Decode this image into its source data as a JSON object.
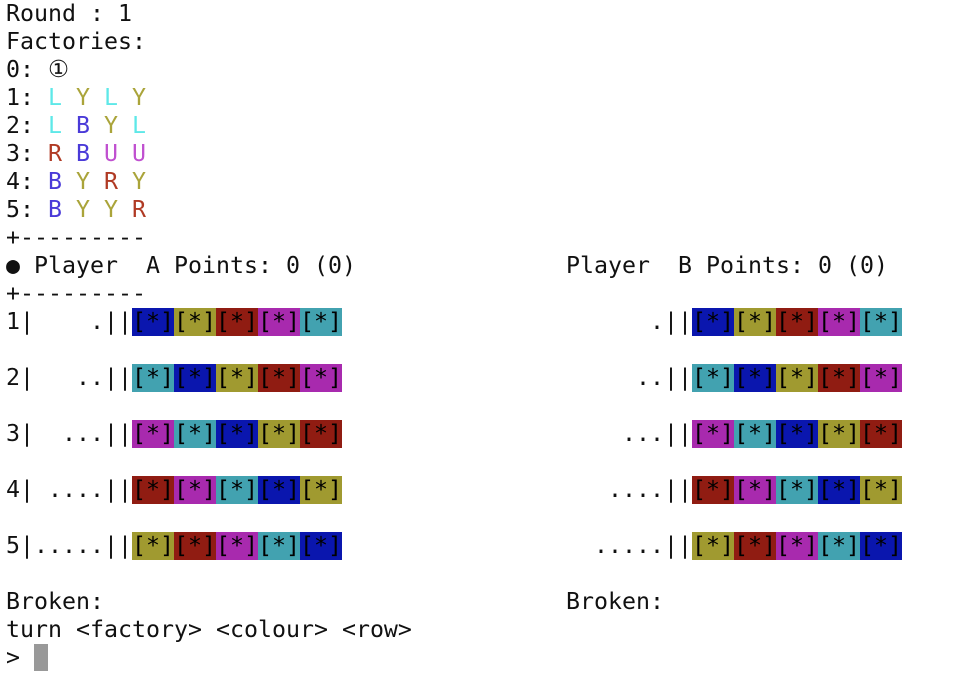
{
  "round_label": "Round : 1",
  "factories_label": "Factories:",
  "factories": [
    {
      "prefix": "0: ",
      "items": [
        {
          "t": "①",
          "c": "#111111"
        }
      ]
    },
    {
      "prefix": "1: ",
      "items": [
        {
          "t": "L",
          "c": "#5ee8e8"
        },
        {
          "t": "Y",
          "c": "#aaa43a"
        },
        {
          "t": "L",
          "c": "#5ee8e8"
        },
        {
          "t": "Y",
          "c": "#aaa43a"
        }
      ]
    },
    {
      "prefix": "2: ",
      "items": [
        {
          "t": "L",
          "c": "#5ee8e8"
        },
        {
          "t": "B",
          "c": "#4a3ad8"
        },
        {
          "t": "Y",
          "c": "#aaa43a"
        },
        {
          "t": "L",
          "c": "#5ee8e8"
        }
      ]
    },
    {
      "prefix": "3: ",
      "items": [
        {
          "t": "R",
          "c": "#b03a24"
        },
        {
          "t": "B",
          "c": "#4a3ad8"
        },
        {
          "t": "U",
          "c": "#c050d0"
        },
        {
          "t": "U",
          "c": "#c050d0"
        }
      ]
    },
    {
      "prefix": "4: ",
      "items": [
        {
          "t": "B",
          "c": "#4a3ad8"
        },
        {
          "t": "Y",
          "c": "#aaa43a"
        },
        {
          "t": "R",
          "c": "#b03a24"
        },
        {
          "t": "Y",
          "c": "#aaa43a"
        }
      ]
    },
    {
      "prefix": "5: ",
      "items": [
        {
          "t": "B",
          "c": "#4a3ad8"
        },
        {
          "t": "Y",
          "c": "#aaa43a"
        },
        {
          "t": "Y",
          "c": "#aaa43a"
        },
        {
          "t": "R",
          "c": "#b03a24"
        }
      ]
    }
  ],
  "divider": "+---------",
  "colors": {
    "blue": "#0a16ae",
    "olive": "#a09a30",
    "red": "#901c12",
    "magenta": "#a82aae",
    "teal": "#42a2b0"
  },
  "tile_label": "[*]",
  "wall_pattern": [
    [
      "blue",
      "olive",
      "red",
      "magenta",
      "teal"
    ],
    [
      "teal",
      "blue",
      "olive",
      "red",
      "magenta"
    ],
    [
      "magenta",
      "teal",
      "blue",
      "olive",
      "red"
    ],
    [
      "red",
      "magenta",
      "teal",
      "blue",
      "olive"
    ],
    [
      "olive",
      "red",
      "magenta",
      "teal",
      "blue"
    ]
  ],
  "player_a": {
    "active_marker": "●",
    "header": "Player  A Points: 0 (0)",
    "rows": [
      "1|    .||",
      "2|   ..||",
      "3|  ...||",
      "4| ....||",
      "5|.....||"
    ],
    "broken_label": "Broken:"
  },
  "player_b": {
    "header": "Player  B Points: 0 (0)",
    "rows": [
      "    .||",
      "   ..||",
      "  ...||",
      " ....||",
      ".....||"
    ],
    "broken_label": "Broken:"
  },
  "prompt_hint": "turn <factory> <colour> <row>",
  "prompt_symbol": "> "
}
